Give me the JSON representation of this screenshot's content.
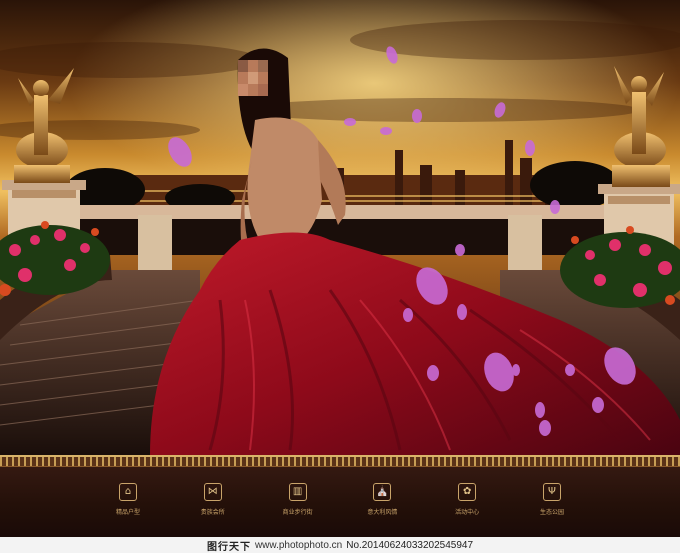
{
  "nav": {
    "items": [
      {
        "icon": "house-icon",
        "glyph": "⌂",
        "label": "精品户型"
      },
      {
        "icon": "bowtie-icon",
        "glyph": "⋈",
        "label": "贵族会所"
      },
      {
        "icon": "building-icon",
        "glyph": "▥",
        "label": "商业步行街"
      },
      {
        "icon": "church-icon",
        "glyph": "⛪",
        "label": "意大利风情"
      },
      {
        "icon": "flower-icon",
        "glyph": "✿",
        "label": "活动中心"
      },
      {
        "icon": "leaf-icon",
        "glyph": "Ψ",
        "label": "生态公园"
      }
    ]
  },
  "watermark": {
    "brand": "图行天下",
    "url": "www.photophoto.cn",
    "number": "No.20140624033202545947"
  },
  "colors": {
    "dress": "#8e0a1a",
    "gold": "#c9a46a",
    "petal": "#c86bd6",
    "sky": "#d8a23a"
  }
}
